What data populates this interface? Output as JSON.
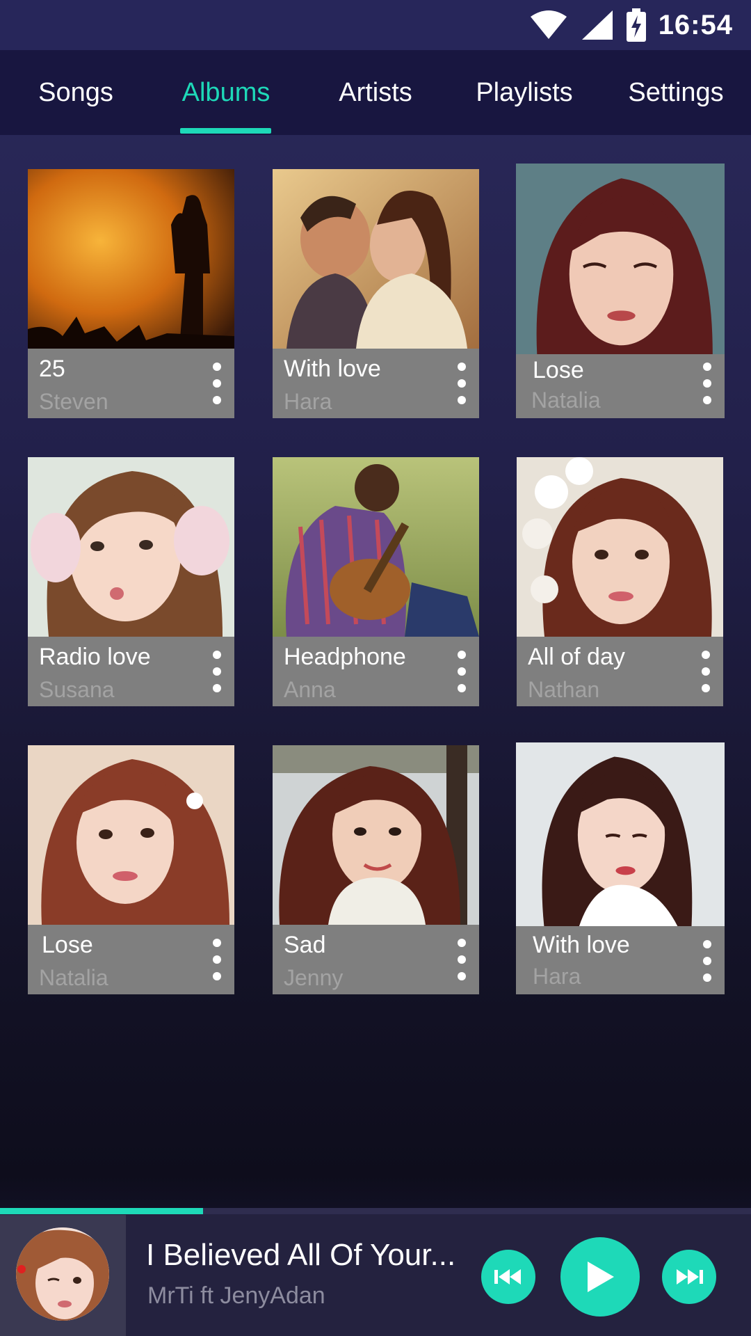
{
  "status_bar": {
    "time": "16:54",
    "icons": [
      "wifi-icon",
      "cell-signal-icon",
      "battery-charging-icon"
    ]
  },
  "tabs": [
    {
      "label": "Songs",
      "active": false
    },
    {
      "label": "Albums",
      "active": true
    },
    {
      "label": "Artists",
      "active": false
    },
    {
      "label": "Playlists",
      "active": false
    },
    {
      "label": "Settings",
      "active": false
    }
  ],
  "albums": [
    {
      "title": "25",
      "artist": "Steven"
    },
    {
      "title": "With love",
      "artist": "Hara"
    },
    {
      "title": "Lose",
      "artist": "Natalia"
    },
    {
      "title": "Radio love",
      "artist": "Susana"
    },
    {
      "title": "Headphone",
      "artist": "Anna"
    },
    {
      "title": "All of day",
      "artist": "Nathan"
    },
    {
      "title": "Lose",
      "artist": "Natalia"
    },
    {
      "title": "Sad",
      "artist": "Jenny"
    },
    {
      "title": "With love",
      "artist": "Hara"
    }
  ],
  "now_playing": {
    "title": "I Believed All Of Your...",
    "artist": "MrTi ft JenyAdan",
    "progress": 0.3,
    "controls": [
      "previous-icon",
      "play-icon",
      "next-icon"
    ]
  },
  "colors": {
    "accent": "#1ed9b8",
    "tab_bar": "#181640",
    "card_info": "#7f7f7f"
  }
}
